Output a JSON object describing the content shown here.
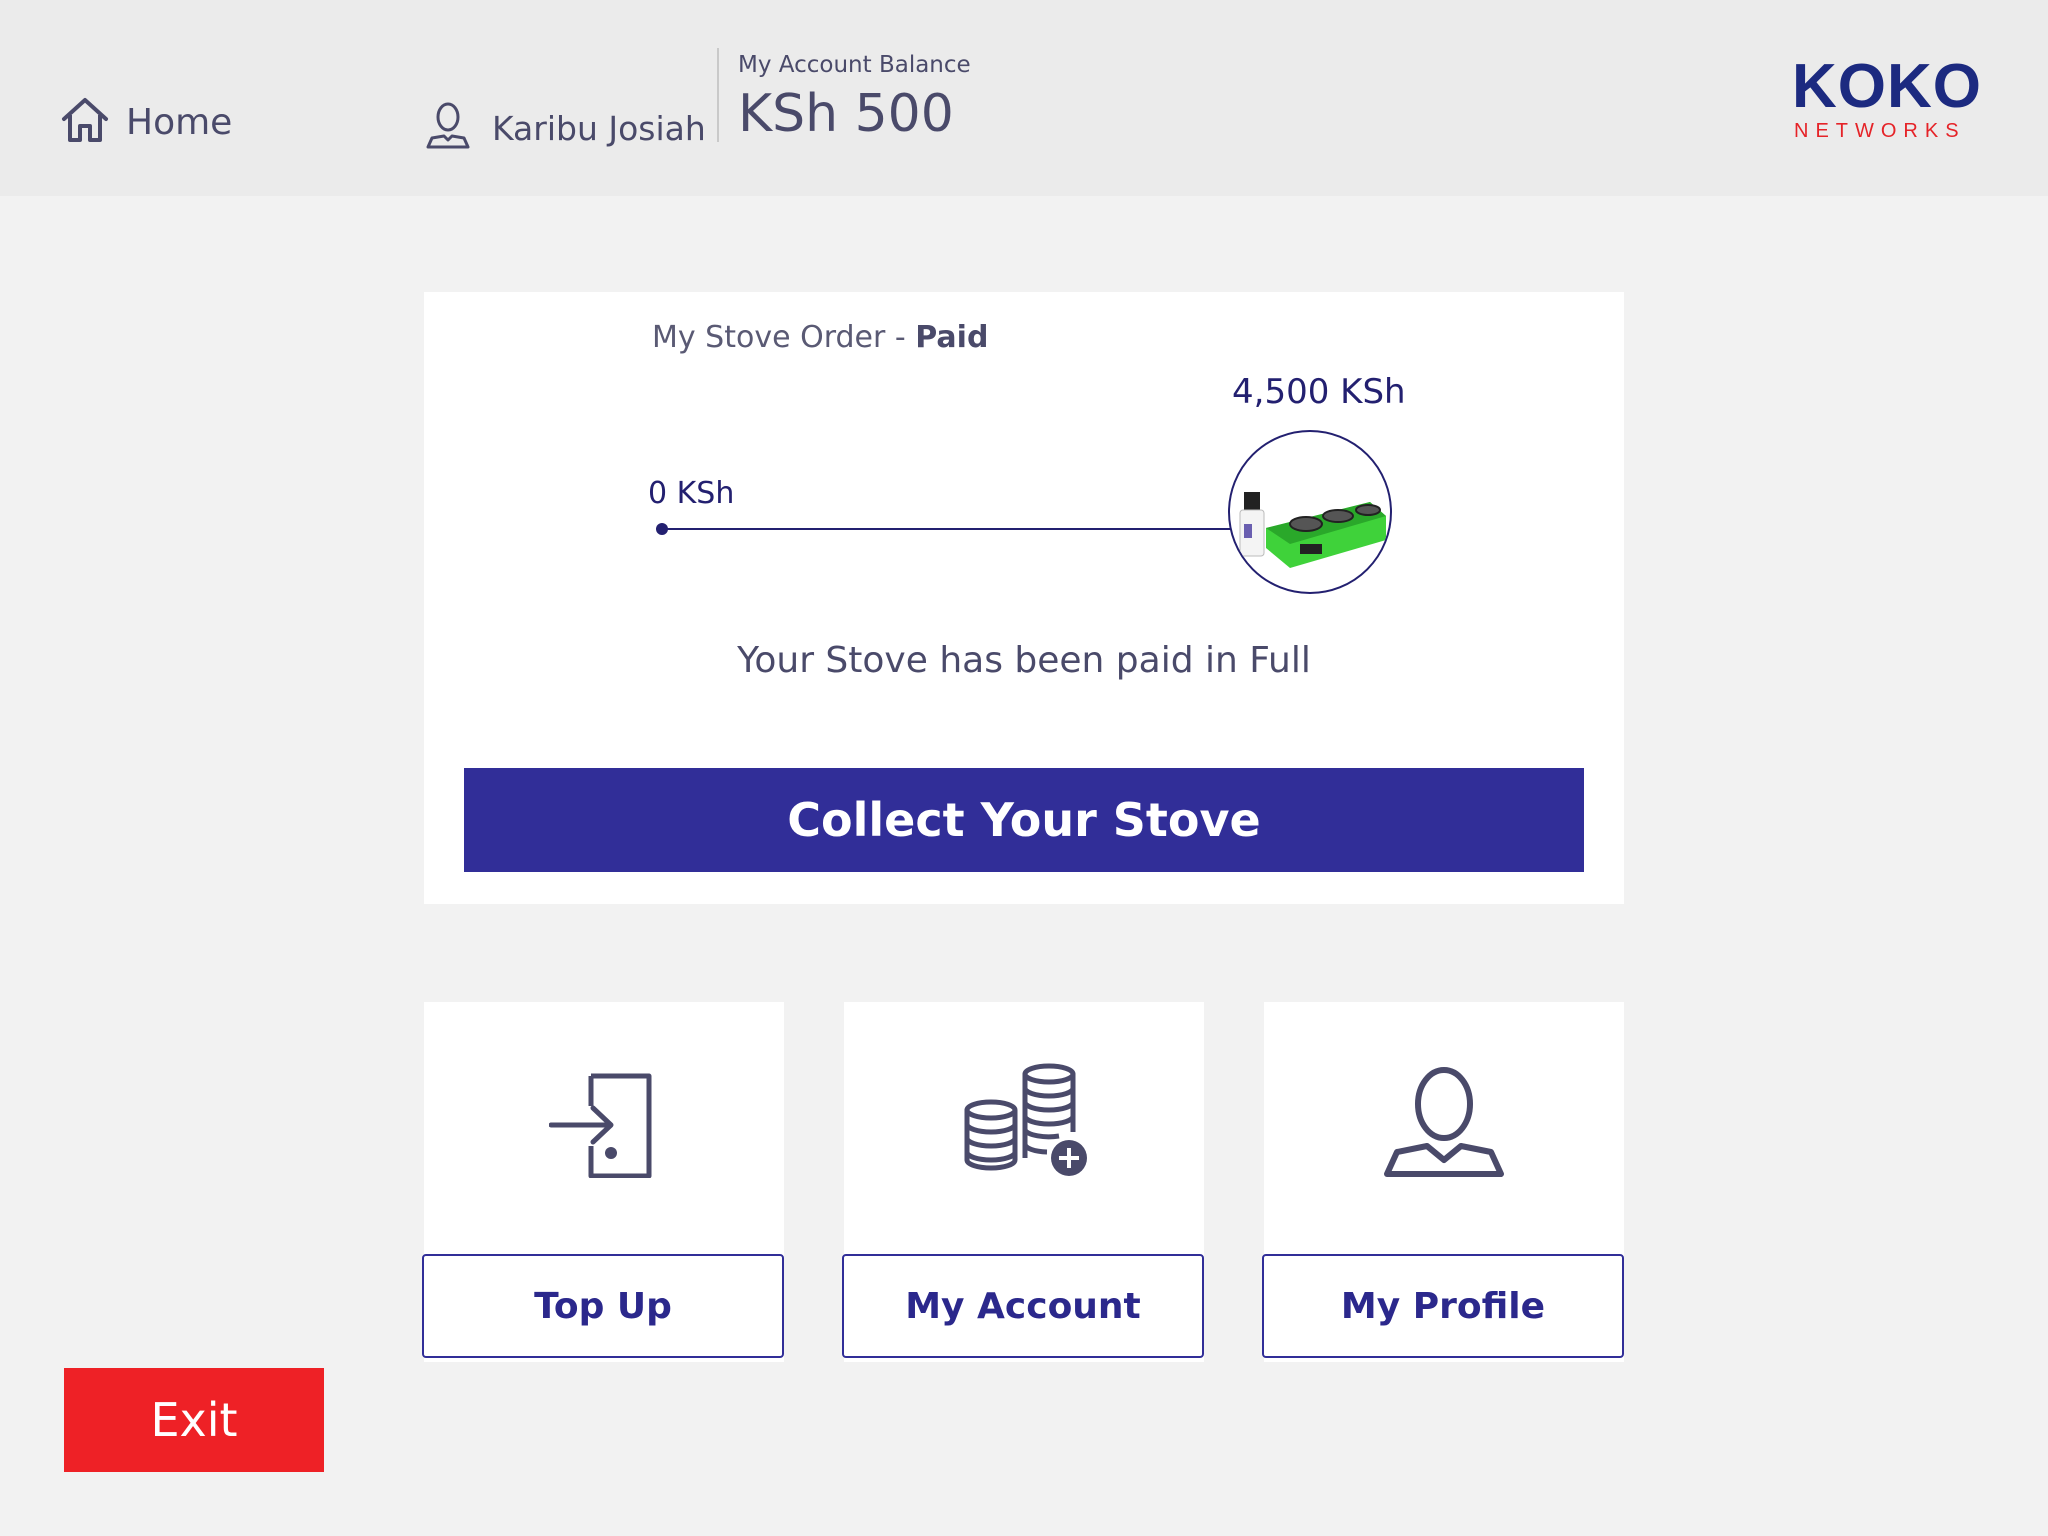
{
  "header": {
    "home_label": "Home",
    "user_name": "Karibu Josiah",
    "balance_label": "My Account Balance",
    "balance_value": "KSh 500",
    "logo_main": "KOKO",
    "logo_sub": "NETWORKS"
  },
  "order": {
    "title_prefix": "My Stove Order - ",
    "title_status": "Paid",
    "start_amount": "0 KSh",
    "end_amount": "4,500 KSh",
    "progress_fraction": 1.0,
    "message": "Your Stove has been paid in Full",
    "collect_label": "Collect Your Stove"
  },
  "tiles": [
    {
      "label": "Top Up",
      "icon": "door-enter-icon"
    },
    {
      "label": "My Account",
      "icon": "coins-plus-icon"
    },
    {
      "label": "My Profile",
      "icon": "person-icon"
    }
  ],
  "exit_label": "Exit",
  "colors": {
    "primary": "#312e98",
    "exit": "#ee2126",
    "logo_blue": "#1c2a80",
    "logo_red": "#e52328"
  }
}
